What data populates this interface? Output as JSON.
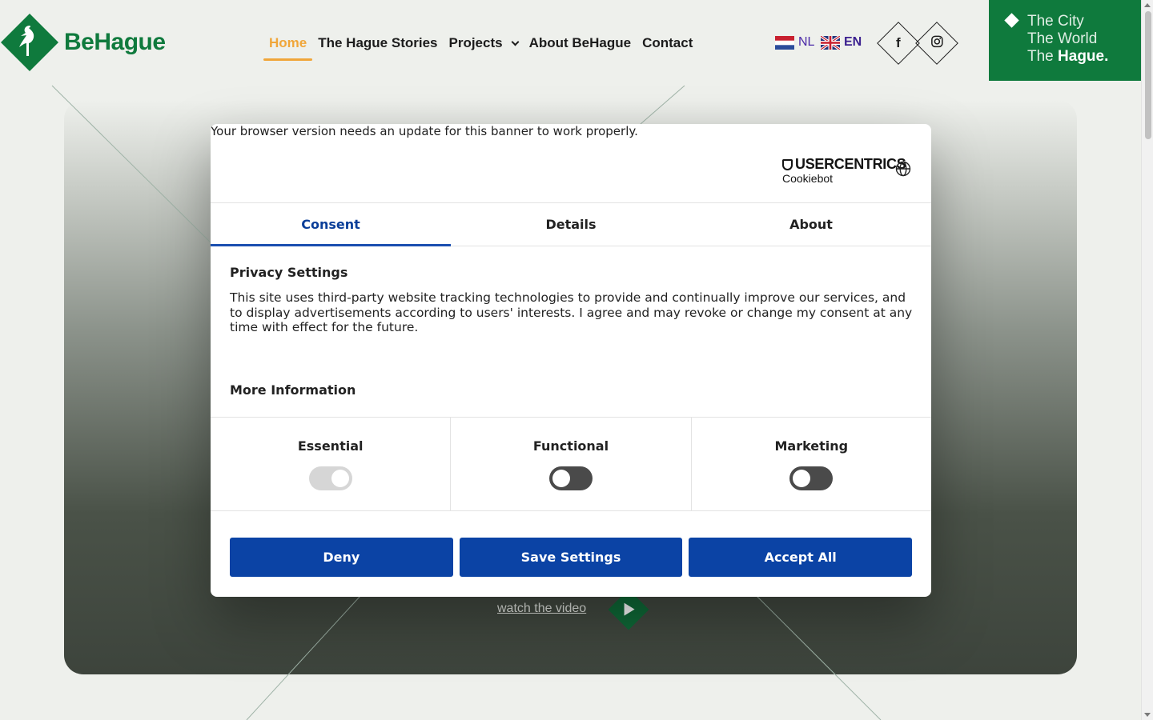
{
  "brand": {
    "name": "BeHague"
  },
  "nav": {
    "items": [
      {
        "label": "Home",
        "active": true
      },
      {
        "label": "The Hague Stories"
      },
      {
        "label": "Projects",
        "has_dropdown": true
      },
      {
        "label": "About BeHague"
      },
      {
        "label": "Contact"
      }
    ]
  },
  "languages": [
    {
      "code": "NL",
      "flag": "netherlands-flag-icon"
    },
    {
      "code": "EN",
      "flag": "uk-flag-icon",
      "selected": true
    }
  ],
  "social": {
    "facebook": "f",
    "instagram": "instagram-icon"
  },
  "tagline": {
    "line1": "The City",
    "line2": "The World",
    "line3_prefix": "The ",
    "line3_bold": "Hague."
  },
  "hero": {
    "video_link": "watch the video"
  },
  "colors": {
    "brand_green": "#0f7a3d",
    "nav_active": "#f0a63a",
    "button_blue": "#0b43a5",
    "tab_active": "#0b3f99"
  },
  "cookie_banner": {
    "update_message": "Your browser version needs an update for this banner to work properly.",
    "provider": {
      "name": "USERCENTRICS",
      "product": "Cookiebot"
    },
    "tabs": [
      {
        "label": "Consent",
        "active": true
      },
      {
        "label": "Details"
      },
      {
        "label": "About"
      }
    ],
    "privacy_title": "Privacy Settings",
    "privacy_text": "This site uses third-party website tracking technologies to provide and continually improve our services, and to display advertisements according to users' interests. I agree and may revoke or change my consent at any time with effect for the future.",
    "more_info_title": "More Information",
    "categories": [
      {
        "label": "Essential",
        "state": "on-disabled"
      },
      {
        "label": "Functional",
        "state": "off"
      },
      {
        "label": "Marketing",
        "state": "off"
      }
    ],
    "buttons": {
      "deny": "Deny",
      "save": "Save Settings",
      "accept": "Accept All"
    }
  }
}
